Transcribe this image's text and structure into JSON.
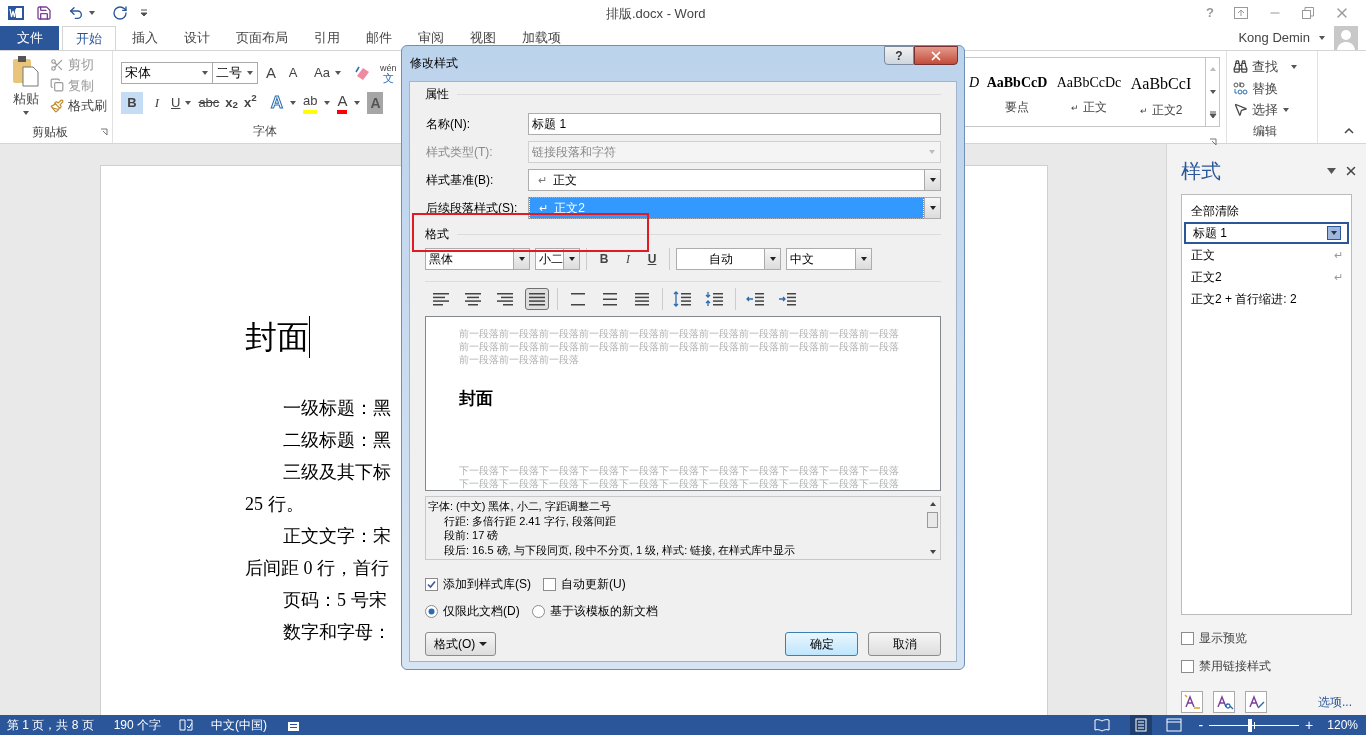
{
  "title_bar": {
    "title": "排版.docx - Word",
    "help": "?",
    "user": "Kong Demin"
  },
  "ribbon_tabs": [
    {
      "label": "文件",
      "kind": "file",
      "selected": false
    },
    {
      "label": "开始",
      "kind": "tab",
      "selected": true
    },
    {
      "label": "插入",
      "kind": "tab",
      "selected": false
    },
    {
      "label": "设计",
      "kind": "tab",
      "selected": false
    },
    {
      "label": "页面布局",
      "kind": "tab",
      "selected": false
    },
    {
      "label": "引用",
      "kind": "tab",
      "selected": false
    },
    {
      "label": "邮件",
      "kind": "tab",
      "selected": false
    },
    {
      "label": "审阅",
      "kind": "tab",
      "selected": false
    },
    {
      "label": "视图",
      "kind": "tab",
      "selected": false
    },
    {
      "label": "加载项",
      "kind": "tab",
      "selected": false
    }
  ],
  "clipboard": {
    "paste": "粘贴",
    "cut": "剪切",
    "copy": "复制",
    "painter": "格式刷",
    "label": "剪贴板"
  },
  "font_group": {
    "font": "宋体",
    "size": "二号",
    "grow": "A",
    "shrink": "A",
    "change_case": "Aa",
    "phonetic_top": "wén",
    "phonetic_bottom": "文",
    "bold": "B",
    "bold_on": true,
    "italic": "I",
    "underline": "U",
    "strike": "abc",
    "subscript": "x$_{2}$",
    "superscript": "x$^{2}$",
    "effects": "A",
    "highlight": "ab",
    "font_color": "A",
    "shading": "A",
    "label": "字体"
  },
  "style_gallery": [
    {
      "sample": "D",
      "kind": "italic"
    },
    {
      "sample": "AaBbCcD",
      "name": "要点",
      "kind": "bold"
    },
    {
      "sample": "AaBbCcDc",
      "name": "正文",
      "mark": "↵",
      "kind": "plain"
    },
    {
      "sample": "AaBbCcI",
      "name": "正文2",
      "mark": "↵",
      "kind": "large"
    }
  ],
  "editing": {
    "find": "查找",
    "replace": "替换",
    "select": "选择",
    "label": "编辑"
  },
  "document": {
    "heading": "封面",
    "paragraphs": [
      {
        "text": "一级标题：黑",
        "indent": true
      },
      {
        "text": "二级标题：黑",
        "indent": true
      },
      {
        "text": "三级及其下标",
        "indent": true
      },
      {
        "text": "25 行。",
        "indent": false
      },
      {
        "text": "正文文字：宋",
        "indent": true
      },
      {
        "text": "后间距 0 行，首行",
        "indent": false
      },
      {
        "text": "页码：5 号宋",
        "indent": true
      },
      {
        "text": "数字和字母：",
        "indent": true
      }
    ]
  },
  "dialog": {
    "title": "修改样式",
    "help": "?",
    "properties": {
      "heading": "属性",
      "rows": [
        {
          "label": "名称(N):",
          "value": "标题 1",
          "kind": "text",
          "disabled": false,
          "focused": false,
          "annotated": false
        },
        {
          "label": "样式类型(T):",
          "value": "链接段落和字符",
          "kind": "combo",
          "disabled": true,
          "focused": false,
          "annotated": false
        },
        {
          "label": "样式基准(B):",
          "value": "正文",
          "mark": "↵",
          "kind": "combo",
          "disabled": false,
          "focused": false,
          "annotated": false
        },
        {
          "label": "后续段落样式(S):",
          "value": "正文2",
          "mark": "↵",
          "kind": "combo",
          "disabled": false,
          "focused": true,
          "annotated": true
        }
      ]
    },
    "format": {
      "heading": "格式",
      "font": "黑体",
      "size": "小二",
      "bold": "B",
      "italic": "I",
      "underline": "U",
      "font_color": "自动",
      "language": "中文"
    },
    "paragraph_buttons": [
      {
        "kind": "align-left",
        "selected": false
      },
      {
        "kind": "align-center",
        "selected": false
      },
      {
        "kind": "align-right",
        "selected": false
      },
      {
        "kind": "align-justify",
        "selected": true
      },
      {
        "kind": "single",
        "selected": false
      },
      {
        "kind": "one-half",
        "selected": false
      },
      {
        "kind": "double",
        "selected": false
      },
      {
        "kind": "space-more",
        "selected": false
      },
      {
        "kind": "space-less",
        "selected": false
      },
      {
        "kind": "indent-less",
        "selected": false
      },
      {
        "kind": "indent-more",
        "selected": false
      }
    ],
    "preview": {
      "before": [
        "前一段落前一段落前一段落前一段落前一段落前一段落前一段落前一段落前一段落前一段落前一段落",
        "前一段落前一段落前一段落前一段落前一段落前一段落前一段落前一段落前一段落前一段落前一段落",
        "前一段落前一段落前一段落"
      ],
      "sample": "封面",
      "after": [
        "下一段落下一段落下一段落下一段落下一段落下一段落下一段落下一段落下一段落下一段落下一段落",
        "下一段落下一段落下一段落下一段落下一段落下一段落下一段落下一段落下一段落下一段落下一段落"
      ]
    },
    "description": [
      "字体: (中文) 黑体, 小二, 字距调整二号",
      "行距: 多倍行距 2.41 字行, 段落间距",
      "段前: 17 磅",
      "段后: 16.5 磅, 与下段同页, 段中不分页, 1 级, 样式: 链接, 在样式库中显示"
    ],
    "checkboxes": [
      {
        "label": "添加到样式库(S)",
        "checked": true
      },
      {
        "label": "自动更新(U)",
        "checked": false
      }
    ],
    "radios": [
      {
        "label": "仅限此文档(D)",
        "selected": true
      },
      {
        "label": "基于该模板的新文档",
        "selected": false
      }
    ],
    "format_button": "格式(O)",
    "ok": "确定",
    "cancel": "取消"
  },
  "styles_pane": {
    "title": "样式",
    "items": [
      {
        "label": "全部清除",
        "selected": false
      },
      {
        "label": "标题 1",
        "selected": true
      },
      {
        "label": "正文",
        "mark": "↵",
        "selected": false
      },
      {
        "label": "正文2",
        "mark": "↵",
        "selected": false
      },
      {
        "label": "正文2 + 首行缩进:  2",
        "selected": false
      }
    ],
    "checkboxes": [
      {
        "label": "显示预览",
        "checked": false
      },
      {
        "label": "禁用链接样式",
        "checked": false
      }
    ],
    "options": "选项..."
  },
  "status_bar": {
    "page": "第 1 页，共 8 页",
    "words": "190 个字",
    "language": "中文(中国)",
    "zoom": {
      "level": 0.45,
      "reading": "120%",
      "minus": "-",
      "plus": "+"
    }
  }
}
